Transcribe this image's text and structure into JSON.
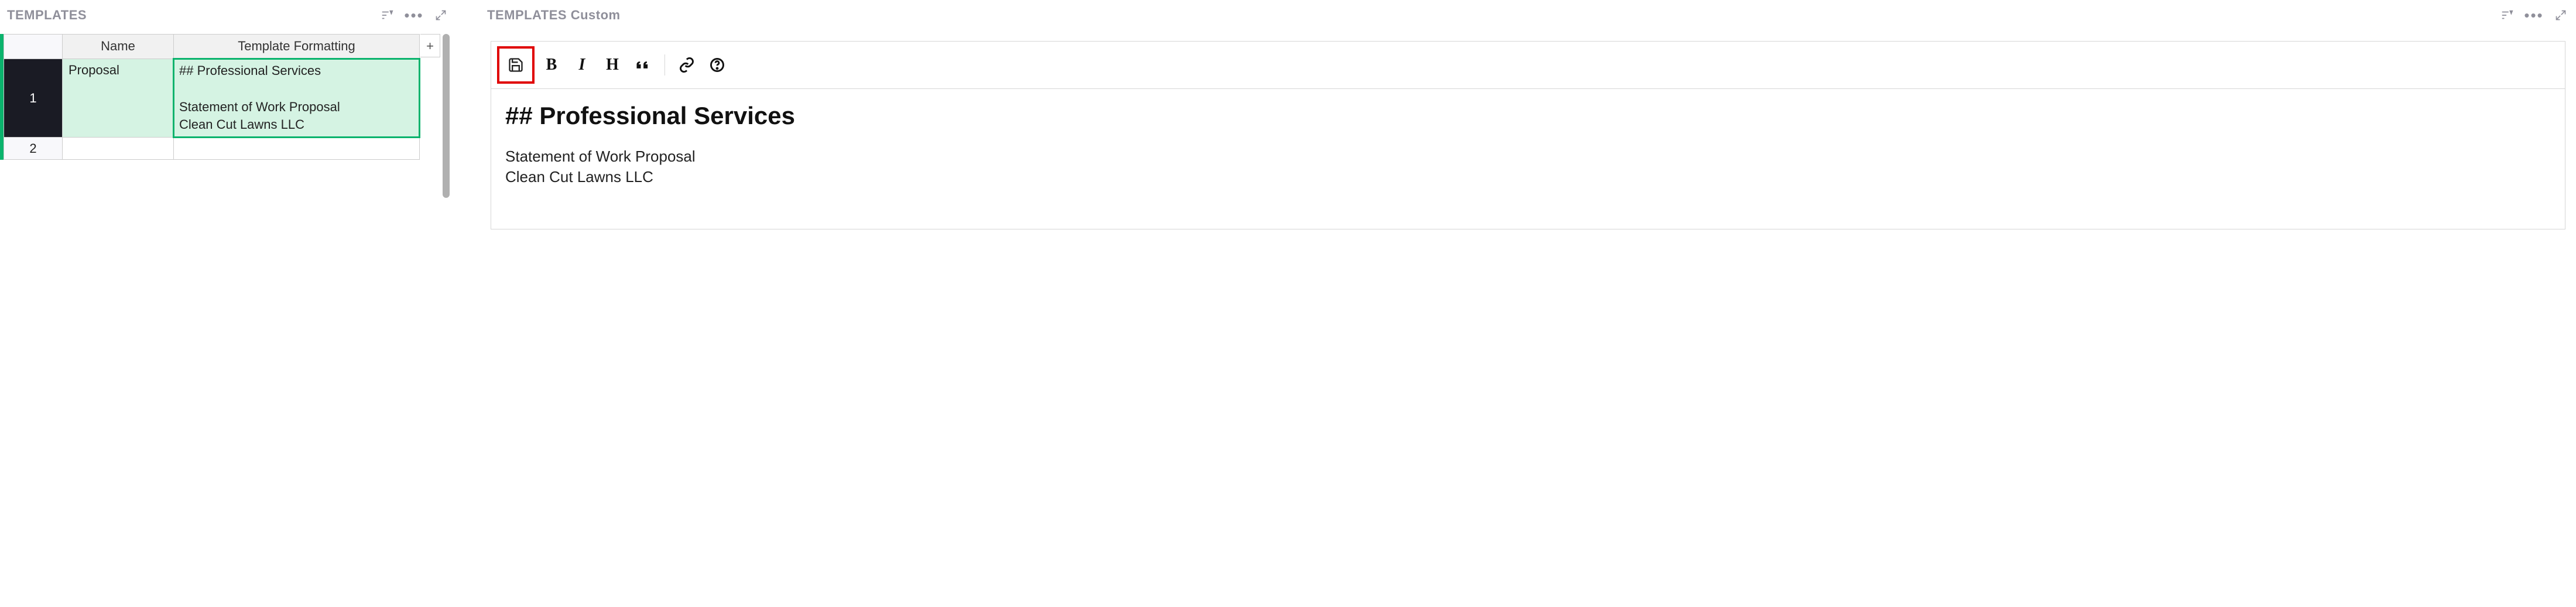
{
  "left": {
    "title": "TEMPLATES",
    "columns": {
      "name": "Name",
      "tf": "Template Formatting"
    },
    "add": "+",
    "rows": [
      {
        "num": "1",
        "name": "Proposal",
        "tf": "## Professional Services\n\nStatement of Work Proposal\nClean Cut Lawns LLC"
      },
      {
        "num": "2",
        "name": "",
        "tf": ""
      }
    ]
  },
  "right": {
    "title": "TEMPLATES Custom",
    "toolbar": {
      "bold": "B",
      "italic": "I",
      "heading": "H"
    },
    "content": {
      "heading": "## Professional Services",
      "line1": "Statement of Work Proposal",
      "line2": "Clean Cut Lawns LLC"
    }
  }
}
